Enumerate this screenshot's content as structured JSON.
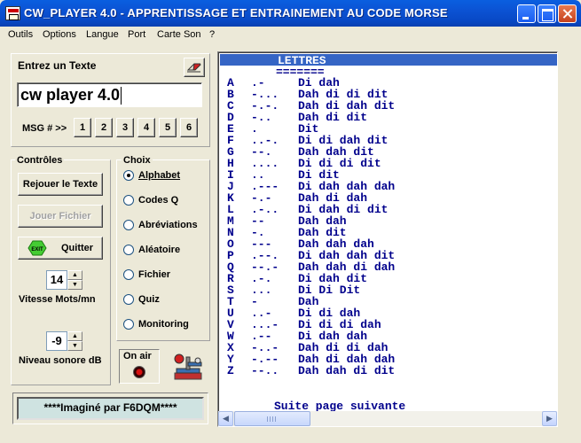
{
  "window": {
    "title": "CW_PLAYER 4.0 - APPRENTISSAGE  ET  ENTRAINEMENT AU  CODE  MORSE"
  },
  "menu": [
    "Outils",
    "Options",
    "Langue",
    "Port",
    "Carte Son",
    "?"
  ],
  "input_panel": {
    "label": "Entrez un Texte",
    "value": "cw player 4.0",
    "msg_label": "MSG # >>",
    "msg_buttons": [
      "1",
      "2",
      "3",
      "4",
      "5",
      "6"
    ]
  },
  "controls": {
    "legend": "Contrôles",
    "replay_label": "Rejouer le Texte",
    "play_file_label": "Jouer Fichier",
    "quit_label": "Quitter",
    "exit_icon_text": "EXIT",
    "speed_value": "14",
    "speed_label": "Vitesse Mots/mn",
    "volume_value": "-9",
    "volume_label": "Niveau sonore dB"
  },
  "choice": {
    "legend": "Choix",
    "options": [
      "Alphabet",
      "Codes Q",
      "Abréviations",
      "Aléatoire",
      "Fichier",
      "Quiz",
      "Monitoring"
    ],
    "selected": "Alphabet"
  },
  "on_air": {
    "label": "On air"
  },
  "credit": "****Imaginé par F6DQM****",
  "display": {
    "heading": "LETTRES",
    "underline": "=======",
    "letters": [
      {
        "letter": "A",
        "code": ".-",
        "phon": "Di dah"
      },
      {
        "letter": "B",
        "code": "-...",
        "phon": "Dah di di dit"
      },
      {
        "letter": "C",
        "code": "-.-.",
        "phon": "Dah di dah dit"
      },
      {
        "letter": "D",
        "code": "-..",
        "phon": "Dah di dit"
      },
      {
        "letter": "E",
        "code": ".",
        "phon": "Dit"
      },
      {
        "letter": "F",
        "code": "..-.",
        "phon": "Di di dah dit"
      },
      {
        "letter": "G",
        "code": "--.",
        "phon": "Dah dah dit"
      },
      {
        "letter": "H",
        "code": "....",
        "phon": "Di di di dit"
      },
      {
        "letter": "I",
        "code": "..",
        "phon": "Di dit"
      },
      {
        "letter": "J",
        "code": ".---",
        "phon": "Di dah dah dah"
      },
      {
        "letter": "K",
        "code": "-.-",
        "phon": "Dah di dah"
      },
      {
        "letter": "L",
        "code": ".-..",
        "phon": "Di dah di dit"
      },
      {
        "letter": "M",
        "code": "--",
        "phon": "Dah dah"
      },
      {
        "letter": "N",
        "code": "-.",
        "phon": "Dah dit"
      },
      {
        "letter": "O",
        "code": "---",
        "phon": "Dah dah dah"
      },
      {
        "letter": "P",
        "code": ".--.",
        "phon": "Di dah dah dit"
      },
      {
        "letter": "Q",
        "code": "--.-",
        "phon": "Dah dah di dah"
      },
      {
        "letter": "R",
        "code": ".-.",
        "phon": "Di dah dit"
      },
      {
        "letter": "S",
        "code": "...",
        "phon": "Di Di Dit"
      },
      {
        "letter": "T",
        "code": "-",
        "phon": "Dah"
      },
      {
        "letter": "U",
        "code": "..-",
        "phon": "Di di dah"
      },
      {
        "letter": "V",
        "code": "...-",
        "phon": "Di di di dah"
      },
      {
        "letter": "W",
        "code": ".--",
        "phon": "Di dah dah"
      },
      {
        "letter": "X",
        "code": "-..-",
        "phon": "Dah di di dah"
      },
      {
        "letter": "Y",
        "code": "-.--",
        "phon": "Dah di dah dah"
      },
      {
        "letter": "Z",
        "code": "--..",
        "phon": "Dah dah di dit"
      }
    ],
    "footer": "Suite page suivante"
  },
  "colors": {
    "titlebar": "#0a54d6",
    "text_blue": "#00008c",
    "header_bar": "#3565c5",
    "credit_bg": "#cfe3e1"
  }
}
